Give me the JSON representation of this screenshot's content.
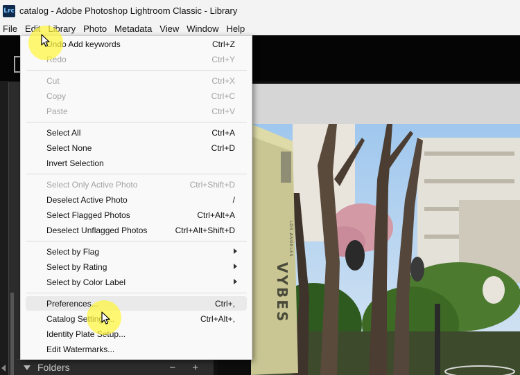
{
  "window": {
    "app_icon_label": "Lrc",
    "title": "catalog - Adobe Photoshop Lightroom Classic - Library"
  },
  "menubar": {
    "items": [
      "File",
      "Edit",
      "Library",
      "Photo",
      "Metadata",
      "View",
      "Window",
      "Help"
    ]
  },
  "edit_menu": {
    "items": [
      {
        "label": "Undo Add keywords",
        "shortcut": "Ctrl+Z",
        "enabled": true
      },
      {
        "label": "Redo",
        "shortcut": "Ctrl+Y",
        "enabled": false
      },
      {
        "label": "Cut",
        "shortcut": "Ctrl+X",
        "enabled": false
      },
      {
        "label": "Copy",
        "shortcut": "Ctrl+C",
        "enabled": false
      },
      {
        "label": "Paste",
        "shortcut": "Ctrl+V",
        "enabled": false
      },
      {
        "label": "Select All",
        "shortcut": "Ctrl+A",
        "enabled": true
      },
      {
        "label": "Select None",
        "shortcut": "Ctrl+D",
        "enabled": true
      },
      {
        "label": "Invert Selection",
        "shortcut": "",
        "enabled": true
      },
      {
        "label": "Select Only Active Photo",
        "shortcut": "Ctrl+Shift+D",
        "enabled": false
      },
      {
        "label": "Deselect Active Photo",
        "shortcut": "/",
        "enabled": true
      },
      {
        "label": "Select Flagged Photos",
        "shortcut": "Ctrl+Alt+A",
        "enabled": true
      },
      {
        "label": "Deselect Unflagged Photos",
        "shortcut": "Ctrl+Alt+Shift+D",
        "enabled": true
      },
      {
        "label": "Select by Flag",
        "shortcut": "",
        "enabled": true,
        "submenu": true
      },
      {
        "label": "Select by Rating",
        "shortcut": "",
        "enabled": true,
        "submenu": true
      },
      {
        "label": "Select by Color Label",
        "shortcut": "",
        "enabled": true,
        "submenu": true
      },
      {
        "label": "Preferences...",
        "shortcut": "Ctrl+,",
        "enabled": true,
        "highlighted": true
      },
      {
        "label": "Catalog Settings...",
        "shortcut": "Ctrl+Alt+,",
        "enabled": true
      },
      {
        "label": "Identity Plate Setup...",
        "shortcut": "",
        "enabled": true
      },
      {
        "label": "Edit Watermarks...",
        "shortcut": "",
        "enabled": true
      }
    ]
  },
  "left_panel": {
    "folders_label": "Folders",
    "folders_actions": "− +"
  },
  "photo": {
    "sign_text": "VYBES",
    "sign_subtext": "LOS ANGELES"
  },
  "colors": {
    "menu_bg": "#f9f9f9",
    "disabled_text": "#a3a3a3",
    "highlight": "#fff53c",
    "panel_bg": "#2c2c2c"
  }
}
